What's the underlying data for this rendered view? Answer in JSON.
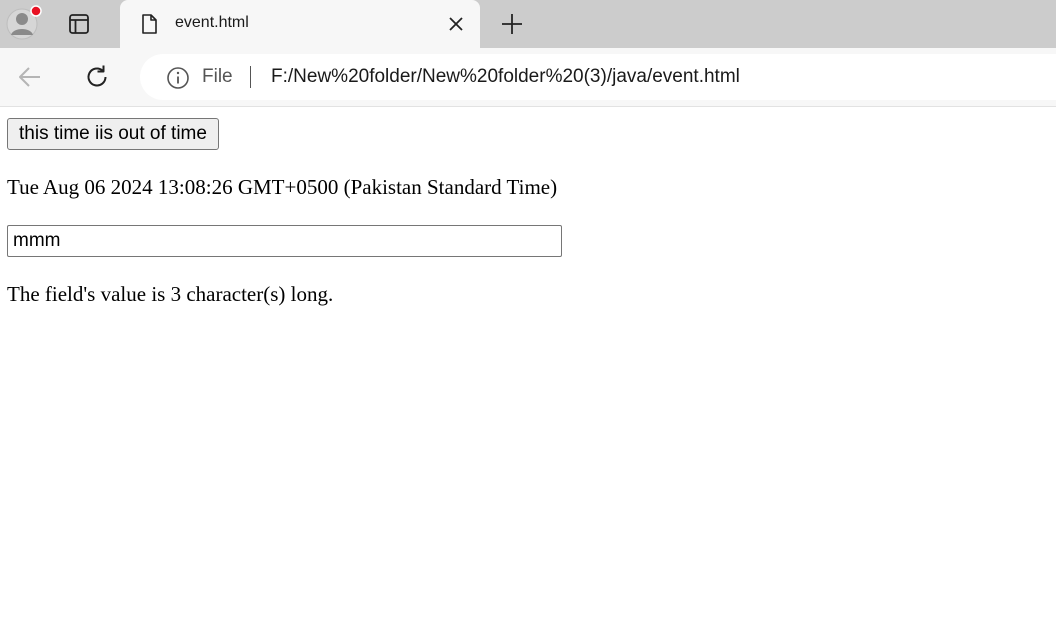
{
  "browser": {
    "tab": {
      "title": "event.html"
    },
    "addressbar": {
      "site_label": "File",
      "url": "F:/New%20folder/New%20folder%20(3)/java/event.html"
    },
    "icons": {
      "profile": "profile-avatar-icon",
      "tab_actions": "tab-actions-icon",
      "page": "document-icon",
      "close": "close-icon",
      "new_tab": "plus-icon",
      "back": "back-arrow-icon",
      "reload": "reload-icon",
      "info": "info-icon"
    },
    "colors": {
      "tabstrip": "#cccccc",
      "toolbar": "#f7f7f7",
      "notification_dot": "#e81123"
    }
  },
  "page": {
    "button_label": "this time iis out of time",
    "date_text": "Tue Aug 06 2024 13:08:26 GMT+0500 (Pakistan Standard Time)",
    "input_value": "mmm",
    "length_message": "The field's value is 3 character(s) long."
  }
}
